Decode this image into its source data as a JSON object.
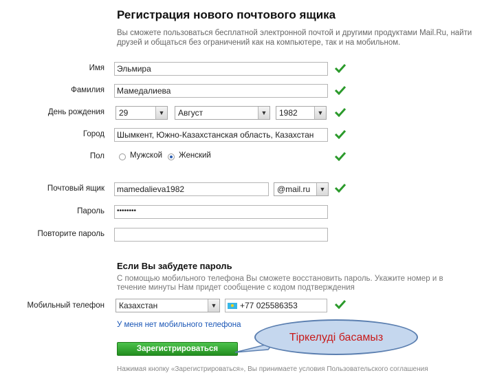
{
  "header": {
    "title": "Регистрация нового почтового ящика",
    "intro": "Вы сможете пользоваться бесплатной электронной почтой и другими продуктами Mail.Ru, найти друзей и общаться без ограничений как на компьютере, так и на мобильном."
  },
  "form": {
    "name_label": "Имя",
    "name_value": "Эльмира",
    "surname_label": "Фамилия",
    "surname_value": "Мамедалиева",
    "birthday_label": "День рождения",
    "birthday_day": "29",
    "birthday_month": "Август",
    "birthday_year": "1982",
    "city_label": "Город",
    "city_value": "Шымкент, Южно-Казахстанская область, Казахстан",
    "gender_label": "Пол",
    "gender_male": "Мужской",
    "gender_female": "Женский",
    "email_label": "Почтовый ящик",
    "email_value": "mamedalieva1982",
    "email_domain": "@mail.ru",
    "password_label": "Пароль",
    "password_value": "••••••••",
    "repeat_label": "Повторите пароль",
    "repeat_value": ""
  },
  "recovery": {
    "title": "Если Вы забудете пароль",
    "text": "С помощью мобильного телефона Вы сможете восстановить пароль. Укажите номер и в течение минуты Нам придет сообщение с кодом подтверждения",
    "phone_label": "Мобильный телефон",
    "country": "Казахстан",
    "phone_value": "+77 025586353",
    "no_phone_link": "У меня нет мобильного телефона"
  },
  "actions": {
    "register_label": "Зарегистрироваться",
    "footer_note": "Нажимая кнопку «Зарегистрироваться», Вы принимаете условия Пользовательского соглашения"
  },
  "annotation": {
    "bubble_text": "Тіркелуді басамыз"
  },
  "colors": {
    "check": "#2b9a2b",
    "button": "#2fa42b",
    "link": "#1a56b6",
    "bubble_fill": "#c5d7ee",
    "bubble_text": "#c81a1a"
  }
}
